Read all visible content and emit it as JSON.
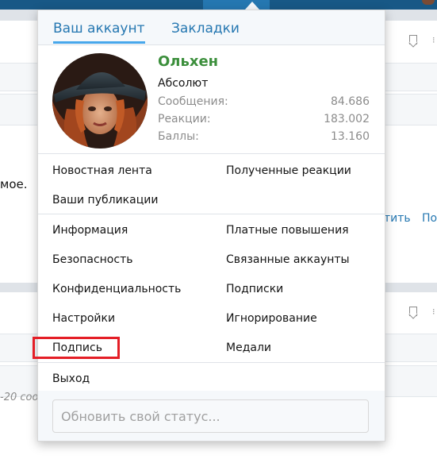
{
  "background": {
    "text_fragment_1": "мое.",
    "link_1": "тить",
    "link_2": "По",
    "italic_fragment": "-20 соо"
  },
  "menu": {
    "tabs": [
      {
        "label": "Ваш аккаунт"
      },
      {
        "label": "Закладки"
      }
    ],
    "profile": {
      "username": "Ольхен",
      "user_title": "Абсолют",
      "stats": [
        {
          "label": "Сообщения:",
          "value": "84.686"
        },
        {
          "label": "Реакции:",
          "value": "183.002"
        },
        {
          "label": "Баллы:",
          "value": "13.160"
        }
      ]
    },
    "links": {
      "news_feed": "Новостная лента",
      "received_reactions": "Полученные реакции",
      "your_posts": "Ваши публикации",
      "information": "Информация",
      "paid_upgrades": "Платные повышения",
      "security": "Безопасность",
      "linked_accounts": "Связанные аккаунты",
      "privacy": "Конфиденциальность",
      "subscriptions": "Подписки",
      "settings": "Настройки",
      "ignoring": "Игнорирование",
      "signature": "Подпись",
      "medals": "Медали",
      "logout": "Выход"
    },
    "status_placeholder": "Обновить свой статус...",
    "highlight_color": "#e41e26"
  },
  "colors": {
    "accent": "#2577b1",
    "username": "#3c8f3c",
    "header": "#185886"
  }
}
